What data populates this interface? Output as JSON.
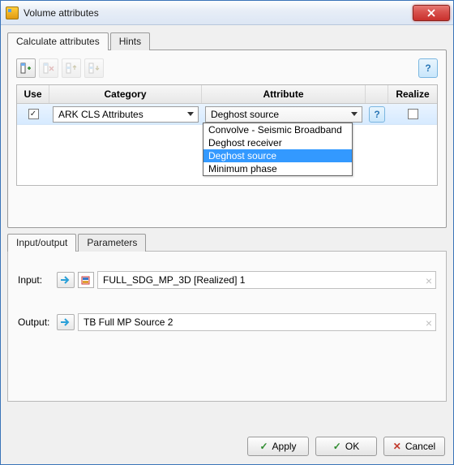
{
  "window": {
    "title": "Volume attributes"
  },
  "main_tabs": {
    "calc": "Calculate attributes",
    "hints": "Hints"
  },
  "grid": {
    "headers": {
      "use": "Use",
      "category": "Category",
      "attribute": "Attribute",
      "realize": "Realize"
    },
    "row": {
      "use_checked": true,
      "category": "ARK CLS Attributes",
      "attribute": "Deghost source",
      "realize_checked": false
    },
    "dropdown": {
      "items": [
        "Convolve - Seismic Broadband",
        "Deghost receiver",
        "Deghost source",
        "Minimum phase"
      ],
      "selected_index": 2
    }
  },
  "sub_tabs": {
    "io": "Input/output",
    "params": "Parameters"
  },
  "io": {
    "input_label": "Input:",
    "output_label": "Output:",
    "input_value": "FULL_SDG_MP_3D [Realized] 1",
    "output_value": "TB Full MP Source 2"
  },
  "buttons": {
    "apply": "Apply",
    "ok": "OK",
    "cancel": "Cancel"
  },
  "help_glyph": "?"
}
